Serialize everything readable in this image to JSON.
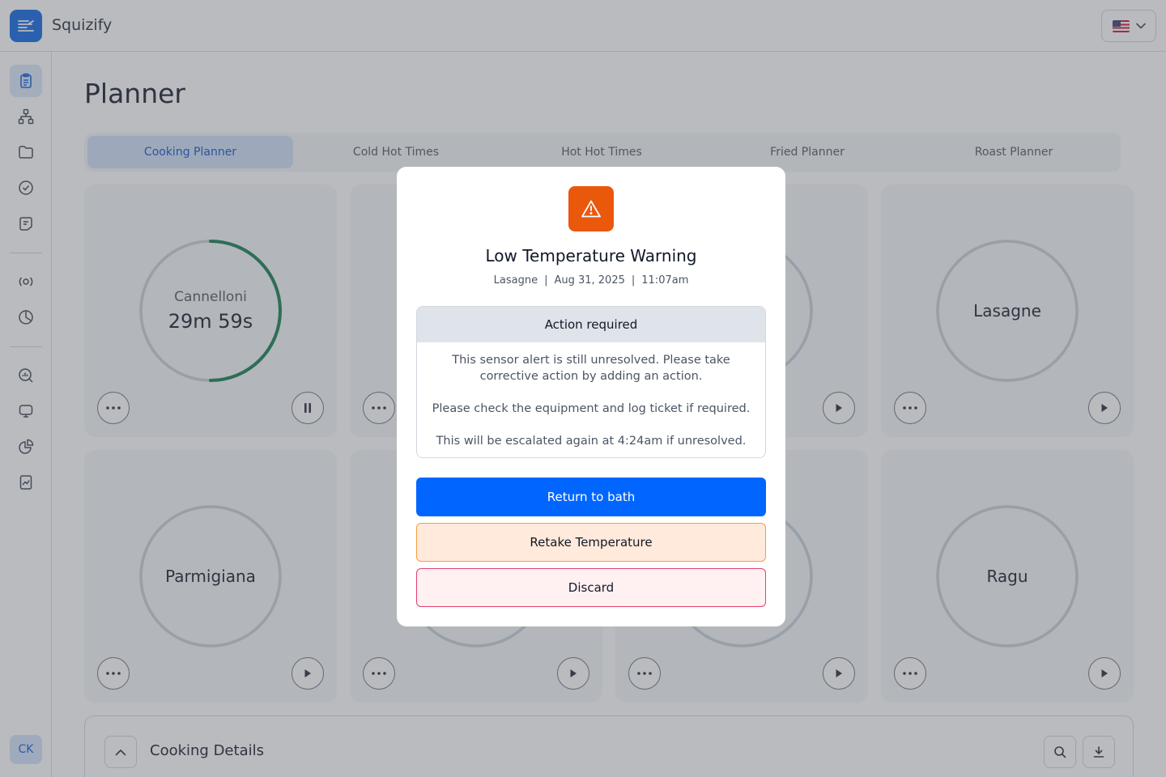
{
  "app": {
    "name": "Squizify"
  },
  "header": {
    "language": "English (US)"
  },
  "sidebar": {
    "icons": [
      "clipboard-icon",
      "hierarchy-icon",
      "folder-icon",
      "check-circle-icon",
      "notes-icon",
      "broadcast-icon",
      "pie-timer-icon",
      "search-chart-icon",
      "monitor-icon",
      "pie-chart-icon",
      "report-icon"
    ],
    "user_initials": "CK"
  },
  "page": {
    "title": "Planner"
  },
  "tabs": [
    "Cooking Planner",
    "Cold Hot Times",
    "Hot Hot Times",
    "Fried Planner",
    "Roast Planner"
  ],
  "active_tab": "Cooking Planner",
  "cards": [
    {
      "name": "Cannelloni",
      "time": "29m 59s",
      "state": "running",
      "progress": 0.5
    },
    {
      "name": "",
      "state": "idle"
    },
    {
      "name": "",
      "state": "idle"
    },
    {
      "name": "Lasagne",
      "state": "idle"
    },
    {
      "name": "Parmigiana",
      "state": "idle"
    },
    {
      "name": "",
      "state": "idle"
    },
    {
      "name": "",
      "state": "idle"
    },
    {
      "name": "Ragu",
      "state": "idle"
    }
  ],
  "details": {
    "title": "Cooking Details"
  },
  "modal": {
    "title": "Low Temperature Warning",
    "meta": {
      "item": "Lasagne",
      "date": "Aug 31, 2025",
      "time": "11:07am",
      "separator": "|"
    },
    "action_header": "Action required",
    "messages": [
      "This sensor alert is still unresolved. Please take corrective action by adding an action.",
      "Please check the equipment and log ticket if required.",
      "This will be escalated again at 4:24am if unresolved."
    ],
    "buttons": {
      "primary": "Return to bath",
      "retake": "Retake Temperature",
      "discard": "Discard"
    }
  },
  "colors": {
    "brand": "#0b63e5",
    "ring_progress": "#0f7a4f",
    "warning": "#ea580c",
    "primary_button": "#0066ff"
  }
}
